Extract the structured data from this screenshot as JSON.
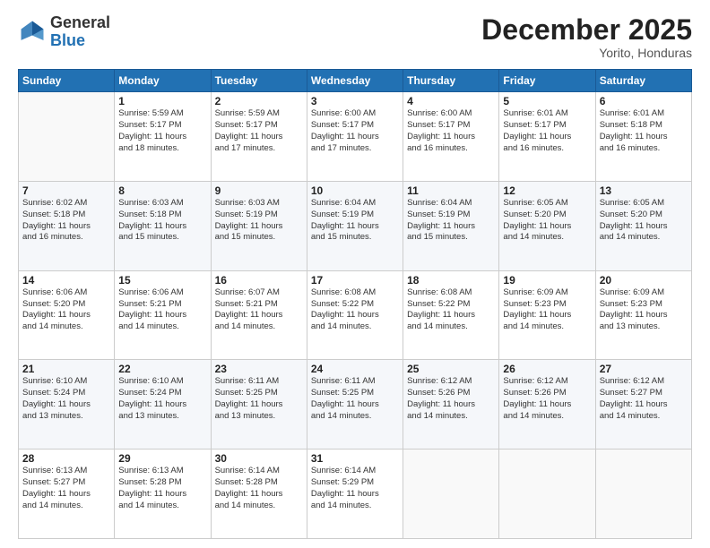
{
  "logo": {
    "general": "General",
    "blue": "Blue"
  },
  "title": "December 2025",
  "subtitle": "Yorito, Honduras",
  "days_header": [
    "Sunday",
    "Monday",
    "Tuesday",
    "Wednesday",
    "Thursday",
    "Friday",
    "Saturday"
  ],
  "weeks": [
    [
      {
        "day": "",
        "info": ""
      },
      {
        "day": "1",
        "info": "Sunrise: 5:59 AM\nSunset: 5:17 PM\nDaylight: 11 hours\nand 18 minutes."
      },
      {
        "day": "2",
        "info": "Sunrise: 5:59 AM\nSunset: 5:17 PM\nDaylight: 11 hours\nand 17 minutes."
      },
      {
        "day": "3",
        "info": "Sunrise: 6:00 AM\nSunset: 5:17 PM\nDaylight: 11 hours\nand 17 minutes."
      },
      {
        "day": "4",
        "info": "Sunrise: 6:00 AM\nSunset: 5:17 PM\nDaylight: 11 hours\nand 16 minutes."
      },
      {
        "day": "5",
        "info": "Sunrise: 6:01 AM\nSunset: 5:17 PM\nDaylight: 11 hours\nand 16 minutes."
      },
      {
        "day": "6",
        "info": "Sunrise: 6:01 AM\nSunset: 5:18 PM\nDaylight: 11 hours\nand 16 minutes."
      }
    ],
    [
      {
        "day": "7",
        "info": "Sunrise: 6:02 AM\nSunset: 5:18 PM\nDaylight: 11 hours\nand 16 minutes."
      },
      {
        "day": "8",
        "info": "Sunrise: 6:03 AM\nSunset: 5:18 PM\nDaylight: 11 hours\nand 15 minutes."
      },
      {
        "day": "9",
        "info": "Sunrise: 6:03 AM\nSunset: 5:19 PM\nDaylight: 11 hours\nand 15 minutes."
      },
      {
        "day": "10",
        "info": "Sunrise: 6:04 AM\nSunset: 5:19 PM\nDaylight: 11 hours\nand 15 minutes."
      },
      {
        "day": "11",
        "info": "Sunrise: 6:04 AM\nSunset: 5:19 PM\nDaylight: 11 hours\nand 15 minutes."
      },
      {
        "day": "12",
        "info": "Sunrise: 6:05 AM\nSunset: 5:20 PM\nDaylight: 11 hours\nand 14 minutes."
      },
      {
        "day": "13",
        "info": "Sunrise: 6:05 AM\nSunset: 5:20 PM\nDaylight: 11 hours\nand 14 minutes."
      }
    ],
    [
      {
        "day": "14",
        "info": "Sunrise: 6:06 AM\nSunset: 5:20 PM\nDaylight: 11 hours\nand 14 minutes."
      },
      {
        "day": "15",
        "info": "Sunrise: 6:06 AM\nSunset: 5:21 PM\nDaylight: 11 hours\nand 14 minutes."
      },
      {
        "day": "16",
        "info": "Sunrise: 6:07 AM\nSunset: 5:21 PM\nDaylight: 11 hours\nand 14 minutes."
      },
      {
        "day": "17",
        "info": "Sunrise: 6:08 AM\nSunset: 5:22 PM\nDaylight: 11 hours\nand 14 minutes."
      },
      {
        "day": "18",
        "info": "Sunrise: 6:08 AM\nSunset: 5:22 PM\nDaylight: 11 hours\nand 14 minutes."
      },
      {
        "day": "19",
        "info": "Sunrise: 6:09 AM\nSunset: 5:23 PM\nDaylight: 11 hours\nand 14 minutes."
      },
      {
        "day": "20",
        "info": "Sunrise: 6:09 AM\nSunset: 5:23 PM\nDaylight: 11 hours\nand 13 minutes."
      }
    ],
    [
      {
        "day": "21",
        "info": "Sunrise: 6:10 AM\nSunset: 5:24 PM\nDaylight: 11 hours\nand 13 minutes."
      },
      {
        "day": "22",
        "info": "Sunrise: 6:10 AM\nSunset: 5:24 PM\nDaylight: 11 hours\nand 13 minutes."
      },
      {
        "day": "23",
        "info": "Sunrise: 6:11 AM\nSunset: 5:25 PM\nDaylight: 11 hours\nand 13 minutes."
      },
      {
        "day": "24",
        "info": "Sunrise: 6:11 AM\nSunset: 5:25 PM\nDaylight: 11 hours\nand 14 minutes."
      },
      {
        "day": "25",
        "info": "Sunrise: 6:12 AM\nSunset: 5:26 PM\nDaylight: 11 hours\nand 14 minutes."
      },
      {
        "day": "26",
        "info": "Sunrise: 6:12 AM\nSunset: 5:26 PM\nDaylight: 11 hours\nand 14 minutes."
      },
      {
        "day": "27",
        "info": "Sunrise: 6:12 AM\nSunset: 5:27 PM\nDaylight: 11 hours\nand 14 minutes."
      }
    ],
    [
      {
        "day": "28",
        "info": "Sunrise: 6:13 AM\nSunset: 5:27 PM\nDaylight: 11 hours\nand 14 minutes."
      },
      {
        "day": "29",
        "info": "Sunrise: 6:13 AM\nSunset: 5:28 PM\nDaylight: 11 hours\nand 14 minutes."
      },
      {
        "day": "30",
        "info": "Sunrise: 6:14 AM\nSunset: 5:28 PM\nDaylight: 11 hours\nand 14 minutes."
      },
      {
        "day": "31",
        "info": "Sunrise: 6:14 AM\nSunset: 5:29 PM\nDaylight: 11 hours\nand 14 minutes."
      },
      {
        "day": "",
        "info": ""
      },
      {
        "day": "",
        "info": ""
      },
      {
        "day": "",
        "info": ""
      }
    ]
  ]
}
